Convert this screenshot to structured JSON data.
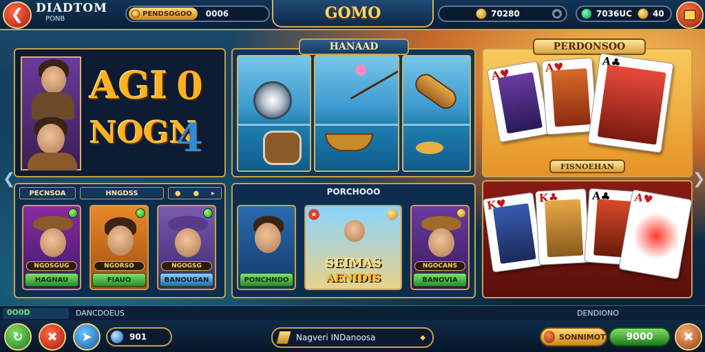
{
  "topbar": {
    "brand_title": "DIADTOM",
    "brand_subtitle": "PONB",
    "currency_btn_label": "PENDSOGOO",
    "currency_value": "0006",
    "game_title": "GOMO",
    "coins_value": "70280",
    "gems_value": "7036UC",
    "level_value": "40"
  },
  "left_panel": {
    "letters_line1": "AGI",
    "letters_line2": "NOGN",
    "num1": "0",
    "num2": "4",
    "tabs": [
      "PECNSOA",
      "HNGDSS"
    ],
    "tiles": [
      {
        "badge": "NGOSGUG",
        "label": "HAGNAU"
      },
      {
        "badge": "NGORSO",
        "label": "FIAUO"
      },
      {
        "badge": "NGOGSG",
        "label": "BANOUGAN"
      }
    ]
  },
  "mid_panel": {
    "banner": "HANAAD",
    "section_label": "PORCHOOO",
    "tiles": [
      {
        "label": "PONCHNDO"
      },
      {
        "title1": "SEIMAS",
        "title2": "AENIDIS"
      },
      {
        "badge": "NGOCANS",
        "label": "BANOVIA"
      }
    ]
  },
  "right_panel": {
    "banner": "PERDONSOO",
    "sub_label": "FISNOEHAN"
  },
  "tabbar": {
    "left": "0O0D",
    "mid": "DANCDOEUS",
    "right": "DENDIONO"
  },
  "bottombar": {
    "gems": "901",
    "notice": "Nagveri INDanoosa",
    "shop_label": "SONNIMOT",
    "balance_btn": "9000"
  },
  "colors": {
    "gold": "#c9a14b",
    "accent_green": "#2c8e2c",
    "accent_red": "#a81a10"
  }
}
